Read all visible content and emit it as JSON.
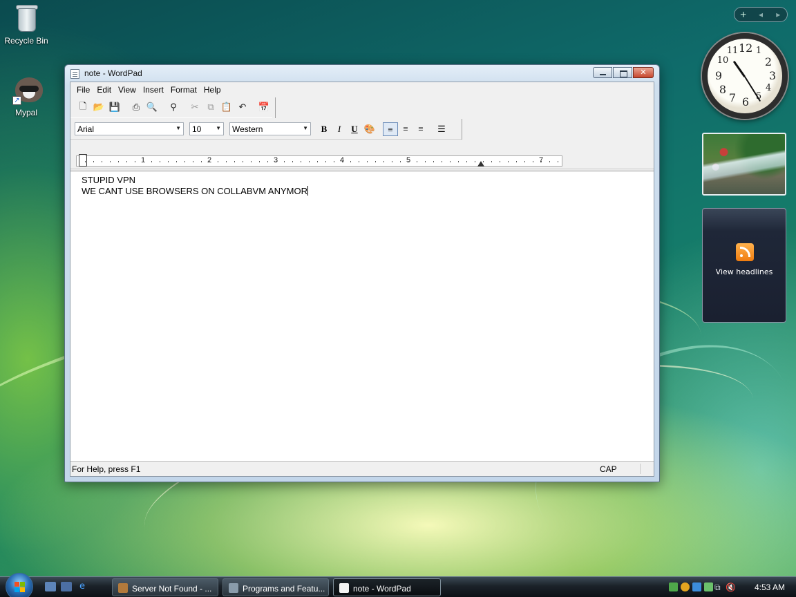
{
  "desktop": {
    "icons": [
      {
        "label": "Recycle Bin"
      },
      {
        "label": "Mypal"
      }
    ]
  },
  "window": {
    "title": "note - WordPad",
    "menu": [
      "File",
      "Edit",
      "View",
      "Insert",
      "Format",
      "Help"
    ],
    "toolbar_icons": [
      "new-icon",
      "open-icon",
      "save-icon",
      "print-icon",
      "print-preview-icon",
      "find-icon",
      "cut-icon",
      "copy-icon",
      "paste-icon",
      "undo-icon",
      "insert-date-time-icon"
    ],
    "format_bar": {
      "font": "Arial",
      "size": "10",
      "script": "Western",
      "bold": "B",
      "italic": "I",
      "underline": "U"
    },
    "ruler_numbers": [
      "1",
      "2",
      "3",
      "4",
      "5",
      "7"
    ],
    "document_lines": [
      "STUPID VPN",
      "WE CANT USE BROWSERS ON COLLABVM ANYMOR"
    ],
    "status": {
      "help": "For Help, press F1",
      "caps": "CAP"
    }
  },
  "sidebar": {
    "gadget_controls": [
      "+",
      "◂",
      "▸"
    ],
    "clock_numbers": [
      "12",
      "1",
      "2",
      "3",
      "4",
      "5",
      "6",
      "7",
      "8",
      "9",
      "10",
      "11"
    ],
    "feed_label": "View headlines"
  },
  "taskbar": {
    "tasks": [
      {
        "label": "Server Not Found - ..."
      },
      {
        "label": "Programs and Featu..."
      },
      {
        "label": "note - WordPad"
      }
    ],
    "time": "4:53 AM"
  },
  "colors": {
    "titlebar": "#cfdfee",
    "close_button": "#c7472e",
    "taskbar": "#1b2229",
    "feed_orange": "#f07c0f"
  }
}
